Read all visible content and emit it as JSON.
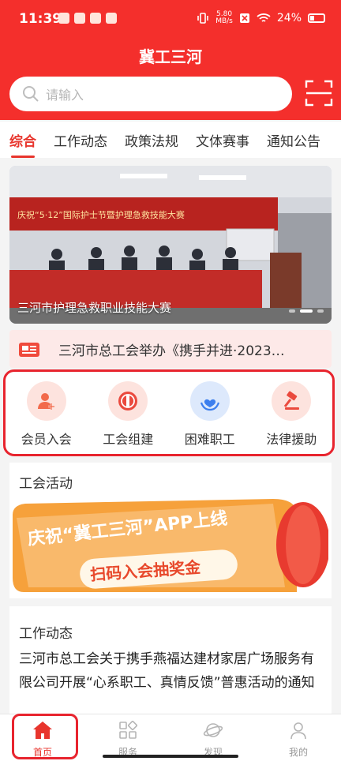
{
  "status_bar": {
    "time": "11:39",
    "net_speed_top": "5.80",
    "net_speed_bottom": "MB/s",
    "battery": "24%"
  },
  "header": {
    "title": "冀工三河",
    "search_placeholder": "请输入"
  },
  "tabs": [
    {
      "label": "综合",
      "active": true
    },
    {
      "label": "工作动态",
      "active": false
    },
    {
      "label": "政策法规",
      "active": false
    },
    {
      "label": "文体赛事",
      "active": false
    },
    {
      "label": "通知公告",
      "active": false
    }
  ],
  "banner": {
    "caption": "三河市护理急救职业技能大赛",
    "photo_banner_text": "庆祝“5·12”国际护士节暨护理急救技能大赛"
  },
  "notice": {
    "text": "三河市总工会举办《携手并进·2023…"
  },
  "quick_actions": [
    {
      "label": "会员入会",
      "icon": "user-add-icon",
      "bg": "#fde3de",
      "fg": "#f26a4b"
    },
    {
      "label": "工会组建",
      "icon": "union-emblem-icon",
      "bg": "#fde3de",
      "fg": "#ea4a3e"
    },
    {
      "label": "困难职工",
      "icon": "heart-hands-icon",
      "bg": "#dde9fc",
      "fg": "#3d7fee"
    },
    {
      "label": "法律援助",
      "icon": "gavel-icon",
      "bg": "#fde3de",
      "fg": "#ea4a3e"
    }
  ],
  "activity": {
    "section_title": "工会活动",
    "promo_headline": "庆祝“冀工三河”APP上线",
    "promo_sub": "扫码入会抽奖金"
  },
  "work_news": {
    "section_title": "工作动态",
    "headline": "三河市总工会关于携手燕福达建材家居广场服务有限公司开展“心系职工、真情反馈”普惠活动的通知"
  },
  "bottom_nav": [
    {
      "label": "首页",
      "icon": "home-icon",
      "active": true
    },
    {
      "label": "服务",
      "icon": "grid-icon",
      "active": false
    },
    {
      "label": "发现",
      "icon": "planet-icon",
      "active": false
    },
    {
      "label": "我的",
      "icon": "person-icon",
      "active": false
    }
  ],
  "colors": {
    "brand_red": "#f42f2c",
    "active_tab": "#e8352d",
    "highlight_border": "#e8242e"
  }
}
